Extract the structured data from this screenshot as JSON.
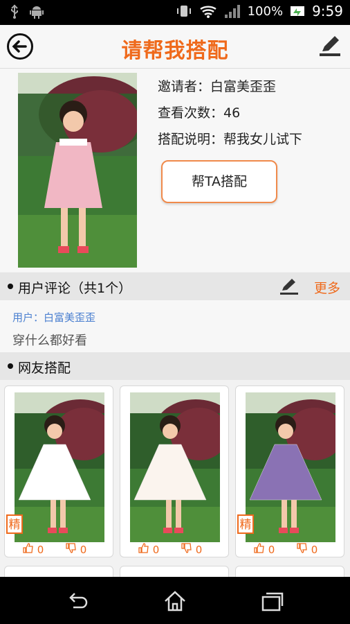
{
  "status": {
    "battery": "100%",
    "time": "9:59"
  },
  "header": {
    "title": "请帮我搭配"
  },
  "invite": {
    "inviter": "邀请者：白富美歪歪",
    "views": "查看次数：46",
    "note": "搭配说明：帮我女儿试下",
    "help_button": "帮TA搭配"
  },
  "comments_section": {
    "title": "用户评论（共1个）",
    "more": "更多"
  },
  "comments": [
    {
      "user": "用户：白富美歪歪",
      "text": "穿什么都好看"
    }
  ],
  "matches_section": {
    "title": "网友搭配"
  },
  "matches": [
    {
      "badge": "精",
      "likes": "0",
      "dislikes": "0",
      "dress_color": "#ffffff"
    },
    {
      "badge": "",
      "likes": "0",
      "dislikes": "0",
      "dress_color": "#fbf4ee"
    },
    {
      "badge": "精",
      "likes": "0",
      "dislikes": "0",
      "dress_color": "#8a72b4"
    }
  ],
  "colors": {
    "accent": "#ef6a1c",
    "link": "#4a7fd0"
  }
}
